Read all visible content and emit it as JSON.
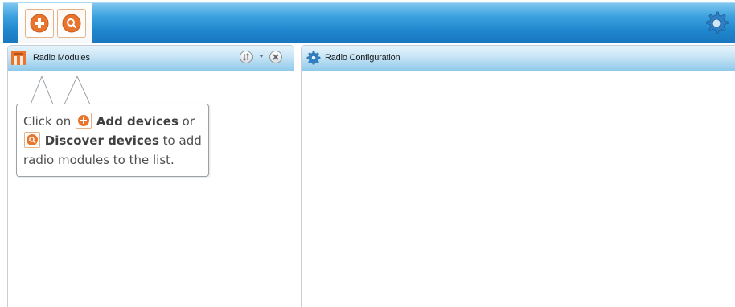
{
  "toolbar": {
    "add_icon": "add-circle-icon",
    "discover_icon": "search-circle-icon",
    "settings_icon": "gear-icon"
  },
  "left_panel": {
    "title": "Radio Modules",
    "icon": "radio-modules-icon",
    "sort_icon": "sort-icon",
    "close_icon": "close-icon"
  },
  "right_panel": {
    "title": "Radio Configuration",
    "icon": "gear-icon"
  },
  "callout": {
    "part1": "Click on ",
    "add_label": "Add devices",
    "part2": " or",
    "discover_label": "Discover devices",
    "part3": " to add radio modules to the list."
  },
  "colors": {
    "accent_orange": "#e8742e",
    "toolbar_blue": "#1f86cd",
    "header_light_blue": "#cbe6f6"
  }
}
